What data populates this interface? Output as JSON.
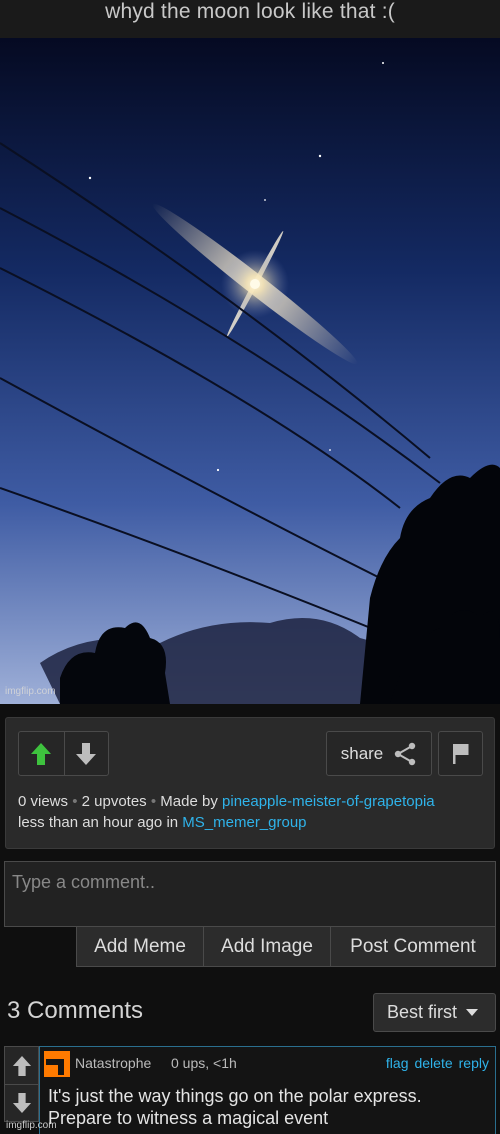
{
  "title": "whyd the moon look like that :(",
  "image": {
    "watermark": "imgflip.com",
    "subject": "moon in night sky with power lines"
  },
  "post": {
    "share_label": "share",
    "views": "0 views",
    "separator": "•",
    "upvotes": "2 upvotes",
    "made_by_label": "Made by",
    "author": "pineapple-meister-of-grapetopia",
    "time_text": "less than an hour ago in",
    "stream": "MS_memer_group"
  },
  "comment_input": {
    "placeholder": "Type a comment.."
  },
  "buttons": {
    "add_meme": "Add Meme",
    "add_image": "Add Image",
    "post_comment": "Post Comment"
  },
  "comments": {
    "header": "3 Comments",
    "sort_value": "Best first",
    "items": [
      {
        "user": "Natastrophe",
        "meta": "0 ups, <1h",
        "actions": [
          "flag",
          "delete",
          "reply"
        ],
        "text": "It's just the way things go on the polar express. Prepare to witness a magical event",
        "watermark": "imgflip.com"
      }
    ]
  },
  "colors": {
    "upvote_green": "#3ec23e",
    "link_blue": "#2fb3ea",
    "avatar_orange": "#ff7a00"
  }
}
